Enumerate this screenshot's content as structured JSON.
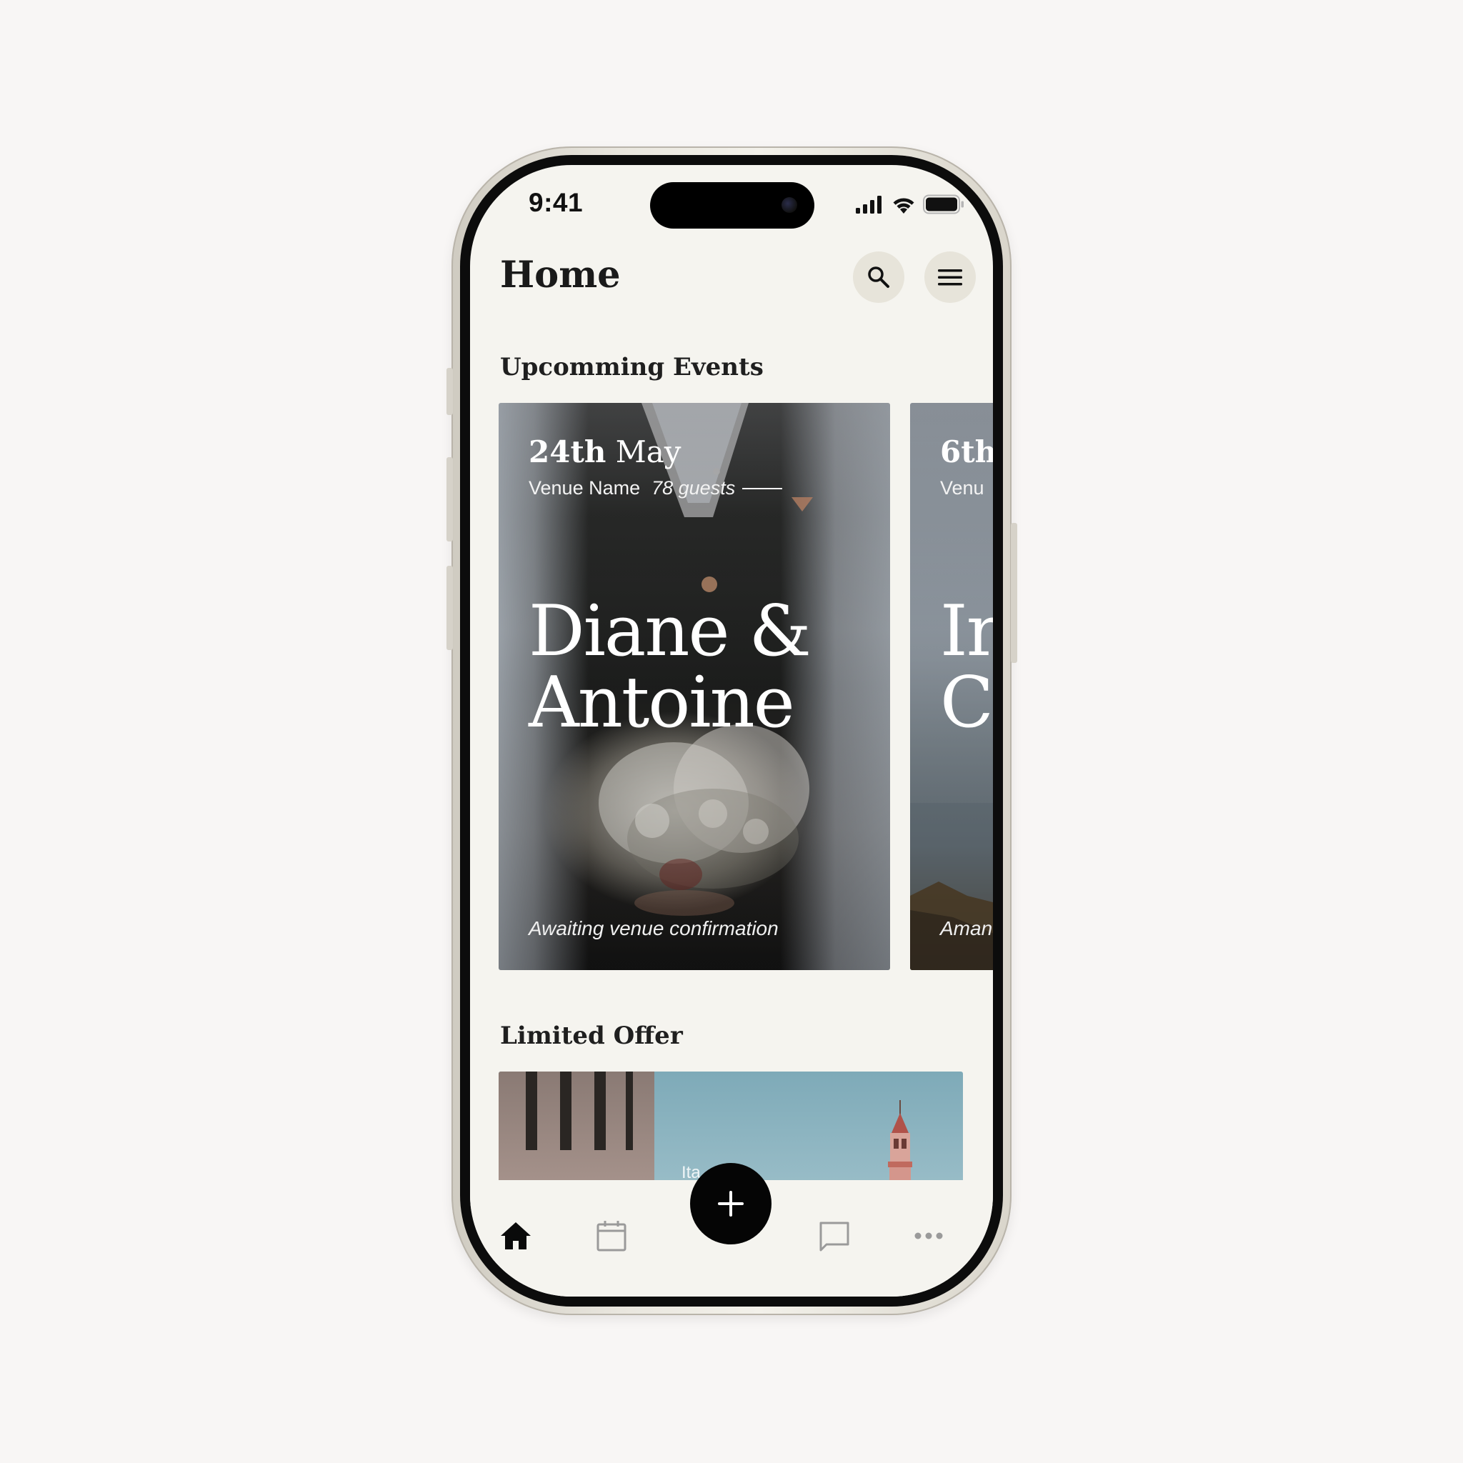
{
  "status_bar": {
    "time": "9:41"
  },
  "header": {
    "title": "Home"
  },
  "sections": {
    "upcoming_title": "Upcomming Events",
    "limited_title": "Limited Offer"
  },
  "events": [
    {
      "date_day": "24th",
      "date_month": "May",
      "venue": "Venue Name",
      "guests": "78 guests",
      "couple_line1": "Diane &",
      "couple_line2": "Antoine",
      "status": "Awaiting venue confirmation"
    },
    {
      "date_day": "6th",
      "venue": "Venu",
      "couple_line1": "Ir",
      "couple_line2": "C",
      "status": "Aman"
    }
  ],
  "offer": {
    "label": "Ita"
  },
  "tab_bar": {
    "items": [
      "home-icon",
      "calendar-icon",
      "add-icon",
      "chat-icon",
      "more-icon"
    ],
    "active": "home"
  },
  "colors": {
    "background": "#f8f6f5",
    "screen": "#f5f4ef",
    "icon_button": "#e7e4da",
    "fab": "#050505",
    "text": "#1a1a1a",
    "inactive_icon": "#9a9a9a"
  }
}
